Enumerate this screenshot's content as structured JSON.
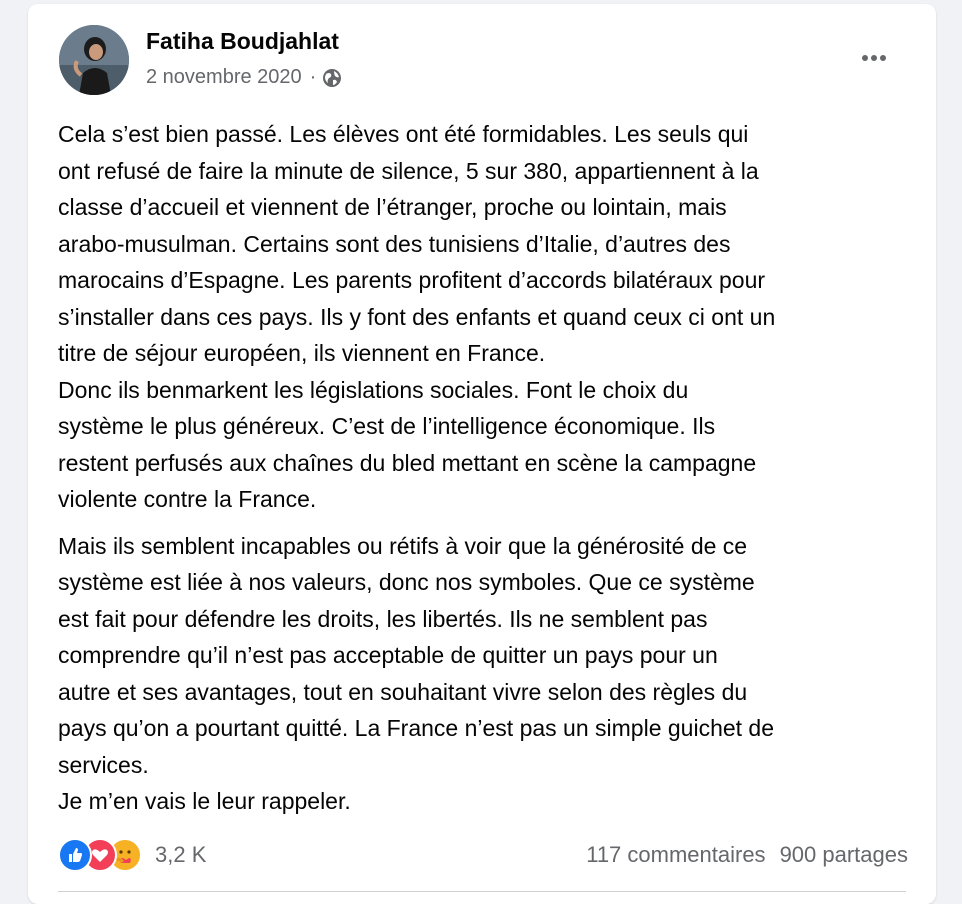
{
  "post": {
    "author": "Fatiha Boudjahlat",
    "date": "2 novembre 2020",
    "separator": "·",
    "privacy_icon": "globe-icon",
    "more_icon": "more-horizontal-icon",
    "paragraphs": [
      [
        "Cela s’est bien passé. Les élèves ont été formidables. Les seuls qui",
        "ont refusé de faire la minute de silence, 5 sur 380, appartiennent à la",
        "classe d’accueil et viennent de l’étranger, proche ou lointain, mais",
        "arabo-musulman. Certains sont des tunisiens d’Italie, d’autres des",
        "marocains d’Espagne. Les parents profitent d’accords bilatéraux pour",
        "s’installer dans ces pays. Ils y font des enfants et quand ceux ci ont un",
        "titre de séjour européen, ils viennent en France.",
        "Donc ils benmarkent les législations sociales. Font le choix du",
        "système le plus généreux. C’est de l’intelligence économique. Ils",
        "restent perfusés aux chaînes du bled mettant en scène la campagne",
        "violente contre la France."
      ],
      [
        "Mais ils semblent incapables ou rétifs à voir que la générosité de ce",
        "système est liée à nos valeurs, donc nos symboles. Que ce système",
        "est fait pour défendre les droits, les libertés. Ils ne semblent pas",
        "comprendre qu’il n’est pas acceptable de quitter un pays pour un",
        "autre et ses avantages, tout en souhaitant vivre selon des règles du",
        "pays qu’on a pourtant quitté. La France n’est pas un simple guichet de",
        "services.",
        "Je m’en vais le leur rappeler."
      ]
    ]
  },
  "footer": {
    "reaction_icons": [
      "like-icon",
      "love-icon",
      "care-icon"
    ],
    "reactions_count": "3,2 K",
    "comments": "117 commentaires",
    "shares": "900 partages"
  },
  "colors": {
    "like": "#1877f2",
    "love": "#f33e58",
    "care": "#f7b125",
    "secondary_text": "#65676b"
  }
}
